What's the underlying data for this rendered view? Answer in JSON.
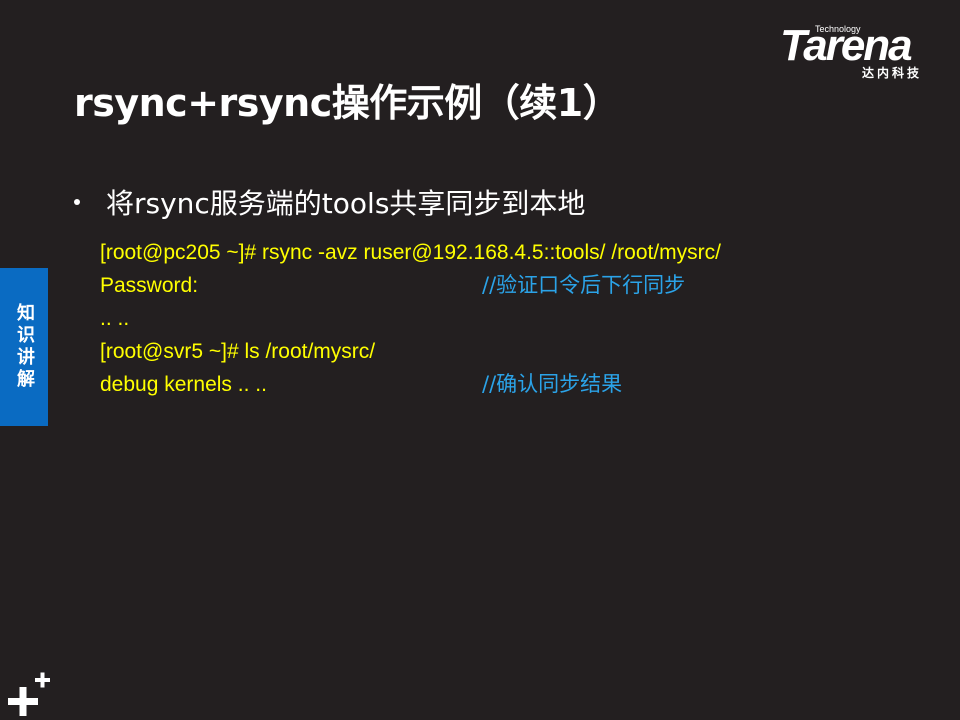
{
  "slide": {
    "title": "rsync+rsync操作示例（续1）",
    "side_tab": "知识讲解",
    "bullet": "将rsync服务端的tools共享同步到本地"
  },
  "logo": {
    "technology": "Technology",
    "wordmark": "Tarena",
    "cn": "达内科技"
  },
  "code": {
    "lines": [
      {
        "text": "[root@pc205 ~]# rsync  -avz  ruser@192.168.4.5::tools/  /root/mysrc/",
        "comment": ""
      },
      {
        "text": "Password:",
        "comment": "//验证口令后下行同步"
      },
      {
        "text": ".. ..",
        "comment": ""
      },
      {
        "text": "[root@svr5 ~]# ls  /root/mysrc/",
        "comment": ""
      },
      {
        "text": "debug   kernels  .. ..",
        "comment": "//确认同步结果"
      }
    ]
  },
  "colors": {
    "background": "#231f20",
    "code_text": "#ffff00",
    "comment_text": "#2ba3e8",
    "side_tab": "#0a6bc2"
  },
  "icons": {
    "corner": "plus-plus-icon"
  }
}
